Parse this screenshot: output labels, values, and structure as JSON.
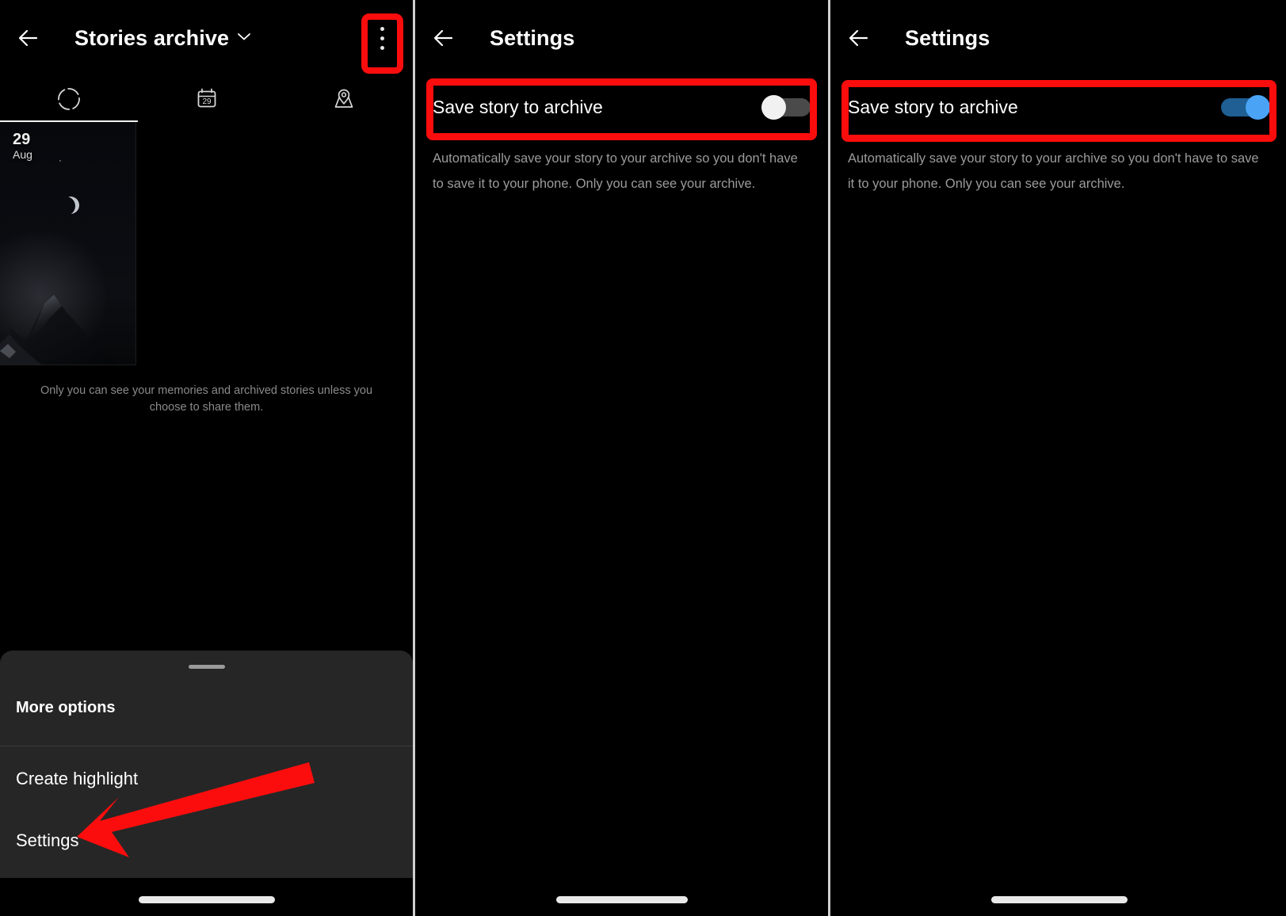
{
  "panels": [
    {
      "name": "stories-archive",
      "header": {
        "back_icon": "arrow-left-icon",
        "title": "Stories archive",
        "chevron_icon": "chevron-down-icon",
        "overflow_icon": "kebab-menu-icon"
      },
      "tabs": [
        {
          "icon": "stories-ring-icon",
          "label": "Stories",
          "active": true
        },
        {
          "icon": "calendar-icon",
          "label": "Calendar",
          "badge": "29",
          "active": false
        },
        {
          "icon": "map-pin-icon",
          "label": "Map",
          "active": false
        }
      ],
      "story": {
        "day": "29",
        "month": "Aug"
      },
      "caption": "Only you can see your memories and archived stories unless you choose to share them.",
      "sheet": {
        "title": "More options",
        "items": [
          {
            "label": "Create highlight"
          },
          {
            "label": "Settings"
          }
        ]
      }
    },
    {
      "name": "settings-toggle-off",
      "header": {
        "back_icon": "arrow-left-icon",
        "title": "Settings"
      },
      "setting": {
        "label": "Save story to archive",
        "toggle_state": "off",
        "description": "Automatically save your story to your archive so you don't have to save it to your phone. Only you can see your archive."
      }
    },
    {
      "name": "settings-toggle-on",
      "header": {
        "back_icon": "arrow-left-icon",
        "title": "Settings"
      },
      "setting": {
        "label": "Save story to archive",
        "toggle_state": "on",
        "description": "Automatically save your story to your archive so you don't have to save it to your phone. Only you can see your archive."
      }
    }
  ],
  "annotations": {
    "highlight_color": "#fb0d0d",
    "arrow_color": "#fb0d0d",
    "arrow_target": "Settings"
  },
  "colors": {
    "background": "#000000",
    "sheet_background": "#262626",
    "toggle_on_knob": "#4aa3f5",
    "toggle_on_track": "#1f5f94",
    "toggle_off_knob": "#f1f1f1",
    "toggle_off_track": "#4a4a4a",
    "primary_text": "#ffffff",
    "secondary_text": "#9b9b9b"
  }
}
